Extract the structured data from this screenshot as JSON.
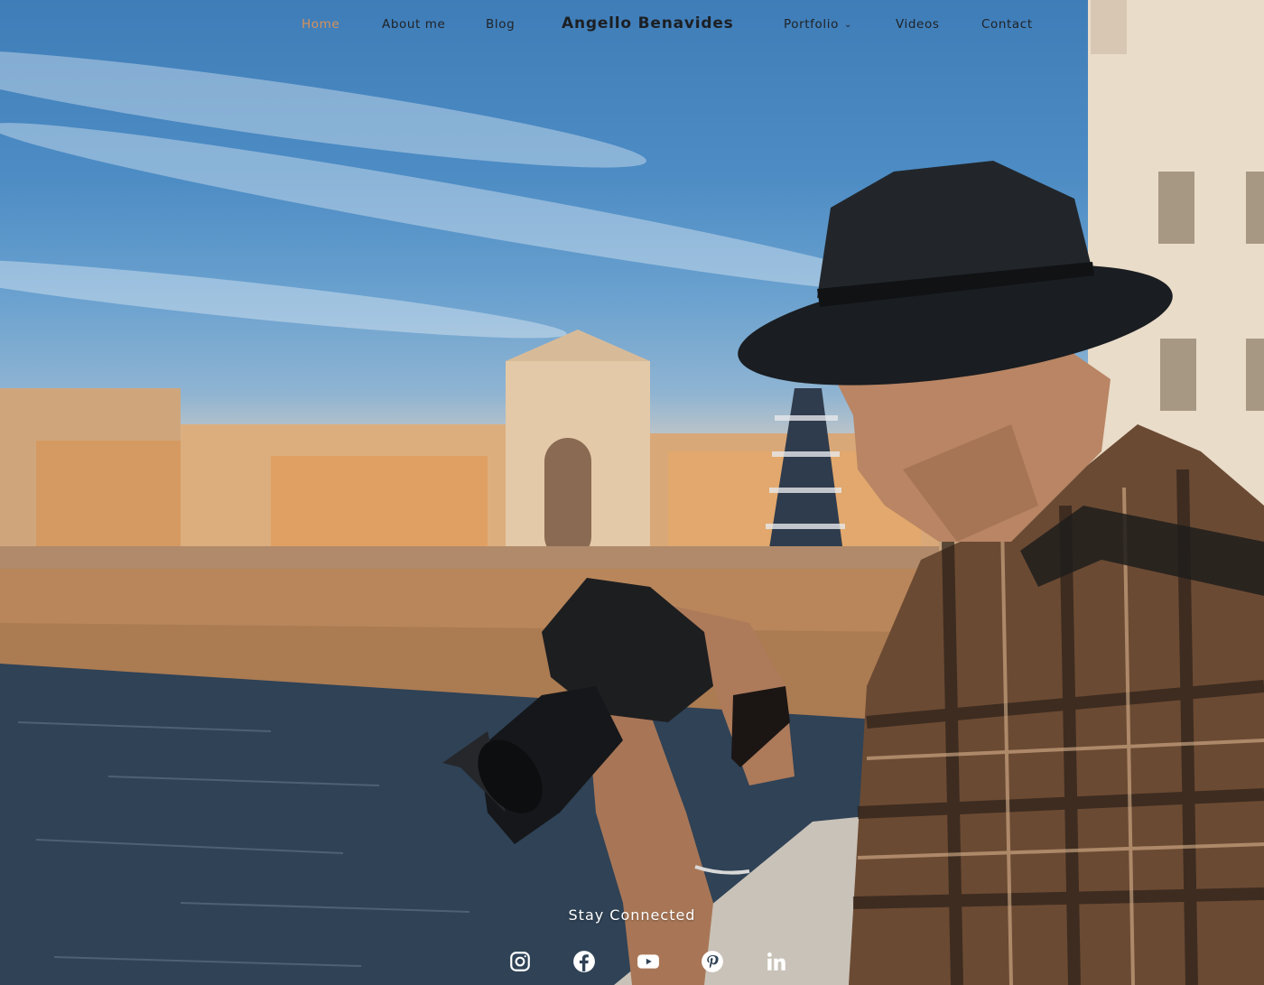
{
  "nav": {
    "left_items": [
      {
        "label": "Home",
        "active": true
      },
      {
        "label": "About me"
      },
      {
        "label": "Blog"
      }
    ],
    "brand": "Angello Benavides",
    "right_items": [
      {
        "label": "Portfolio",
        "has_dropdown": true
      },
      {
        "label": "Videos"
      },
      {
        "label": "Contact"
      }
    ]
  },
  "footer": {
    "stay_connected": "Stay Connected",
    "social_icons": [
      "instagram-icon",
      "facebook-icon",
      "youtube-icon",
      "pinterest-icon",
      "linkedin-icon"
    ]
  },
  "colors": {
    "active_nav": "#d7925b",
    "nav_text": "#1f2226",
    "white": "#ffffff"
  }
}
